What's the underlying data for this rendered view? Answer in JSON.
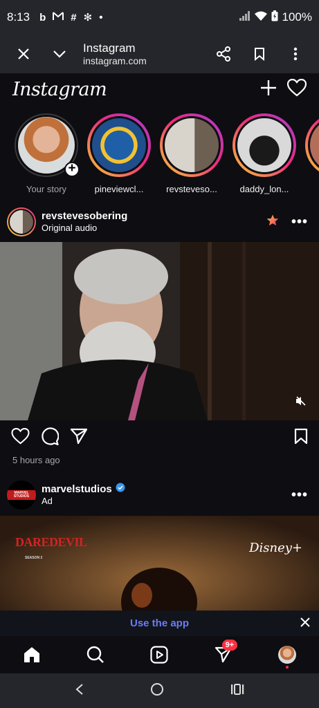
{
  "status_bar": {
    "time": "8:13",
    "notification_icons": [
      "bing-icon",
      "gmail-icon",
      "slack-icon",
      "pinwheel-icon",
      "dot-icon"
    ],
    "battery": "100%"
  },
  "custom_tab": {
    "title": "Instagram",
    "url": "instagram.com"
  },
  "instagram": {
    "logo": "Instagram",
    "stories": [
      {
        "label": "Your story",
        "own": true
      },
      {
        "label": "pineviewcl...",
        "own": false
      },
      {
        "label": "revsteveso...",
        "own": false
      },
      {
        "label": "daddy_lon...",
        "own": false
      }
    ],
    "post1": {
      "username": "revstevesobering",
      "subtitle": "Original audio",
      "time": "5 hours ago"
    },
    "post2": {
      "username": "marvelstudios",
      "subtitle": "Ad",
      "verified": true,
      "brand_tag": "MARVEL STUDIOS",
      "ad_title": "DAREDEVIL",
      "ad_season": "SEASON 2",
      "ad_partner": "Disney+"
    },
    "use_app_label": "Use the app",
    "activity_badge": "9+"
  },
  "colors": {
    "accent": "#6b7cf5",
    "badge": "#ff3040",
    "story_ring_start": "#f9ce34",
    "story_ring_end": "#a73dd6"
  }
}
